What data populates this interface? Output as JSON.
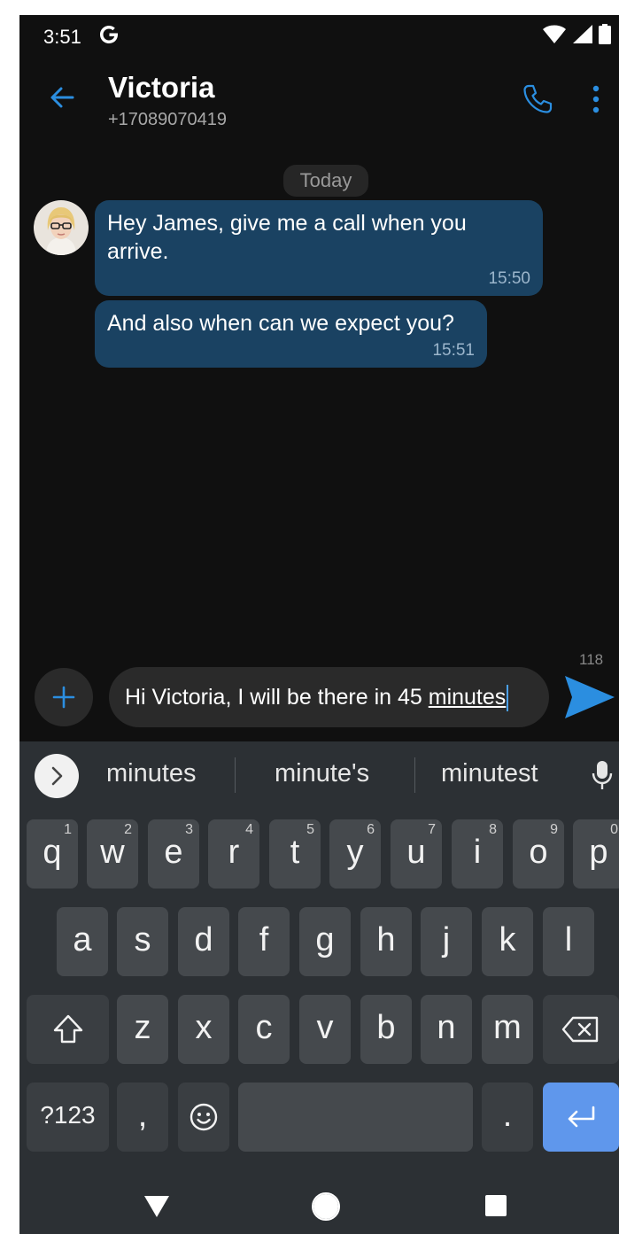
{
  "status_bar": {
    "time": "3:51"
  },
  "header": {
    "contact_name": "Victoria",
    "phone_number": "+17089070419"
  },
  "chat": {
    "date_divider": "Today",
    "messages": [
      {
        "text": "Hey James, give me a call when you arrive.",
        "time": "15:50"
      },
      {
        "text": "And also when can we expect you?",
        "time": "15:51"
      }
    ]
  },
  "compose": {
    "char_count": "118",
    "text_prefix": "Hi Victoria, I will be there in 45 ",
    "text_word": "minutes"
  },
  "keyboard": {
    "suggestions": [
      "minutes",
      "minute's",
      "minutest"
    ],
    "row1": [
      {
        "l": "q",
        "h": "1"
      },
      {
        "l": "w",
        "h": "2"
      },
      {
        "l": "e",
        "h": "3"
      },
      {
        "l": "r",
        "h": "4"
      },
      {
        "l": "t",
        "h": "5"
      },
      {
        "l": "y",
        "h": "6"
      },
      {
        "l": "u",
        "h": "7"
      },
      {
        "l": "i",
        "h": "8"
      },
      {
        "l": "o",
        "h": "9"
      },
      {
        "l": "p",
        "h": "0"
      }
    ],
    "row2": [
      "a",
      "s",
      "d",
      "f",
      "g",
      "h",
      "j",
      "k",
      "l"
    ],
    "row3": [
      "z",
      "x",
      "c",
      "v",
      "b",
      "n",
      "m"
    ],
    "symbols_label": "?123",
    "comma": ",",
    "period": "."
  },
  "colors": {
    "accent": "#2b8ee0",
    "bubble": "#1a4262",
    "enter_key": "#5f97ec"
  },
  "icons": [
    "google-icon",
    "wifi-icon",
    "signal-icon",
    "battery-icon",
    "back-arrow-icon",
    "phone-icon",
    "more-vert-icon",
    "plus-icon",
    "send-icon",
    "chevron-right-icon",
    "mic-icon",
    "shift-icon",
    "backspace-icon",
    "emoji-icon",
    "enter-icon",
    "nav-back-icon",
    "nav-home-icon",
    "nav-recents-icon"
  ]
}
